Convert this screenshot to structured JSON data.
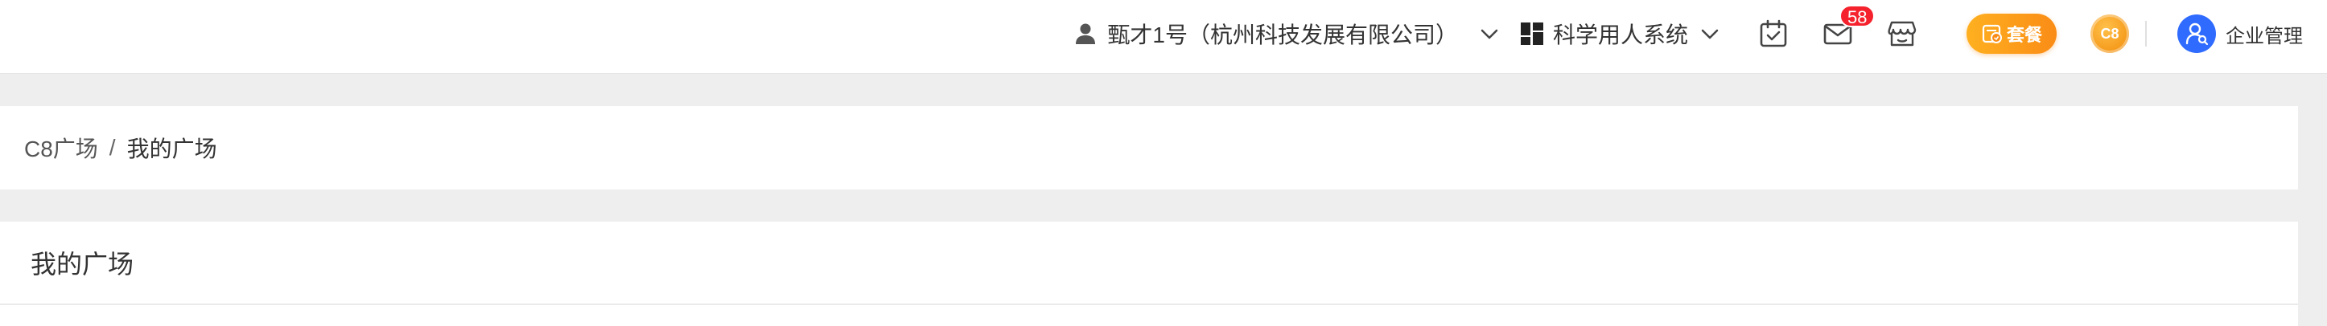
{
  "header": {
    "user_name": "甄才1号（杭州科技发展有限公司）",
    "system_name": "科学用人系统",
    "mail_badge": "58",
    "plan_label": "套餐",
    "coin_label": "C8",
    "admin_label": "企业管理"
  },
  "breadcrumb": {
    "root": "C8广场",
    "separator": "/",
    "current": "我的广场"
  },
  "main": {
    "title": "我的广场"
  },
  "icons": {
    "user": "person-icon",
    "system": "grid-icon",
    "calendar": "calendar-check-icon",
    "mail": "mail-icon",
    "store": "store-icon",
    "plan": "package-icon",
    "admin": "user-admin-icon"
  },
  "colors": {
    "accent_orange": "#fa8c16",
    "badge_red": "#f5222d",
    "admin_blue": "#2f6bff",
    "background": "#eeeeee"
  }
}
